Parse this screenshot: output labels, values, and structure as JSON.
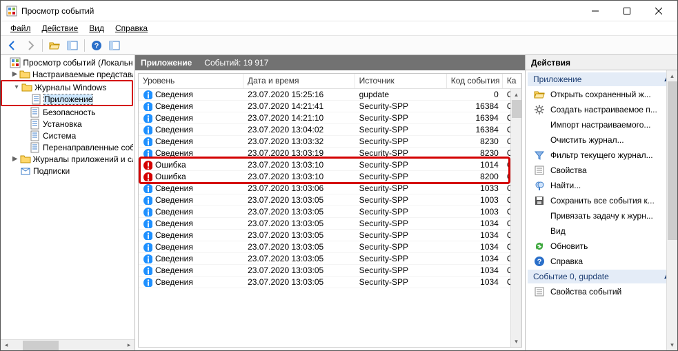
{
  "window": {
    "title": "Просмотр событий"
  },
  "menu": {
    "file": "Файл",
    "action": "Действие",
    "view": "Вид",
    "help": "Справка"
  },
  "tree": {
    "root": "Просмотр событий (Локальны",
    "custom": "Настраиваемые представле",
    "winlogs": "Журналы Windows",
    "application": "Приложение",
    "security": "Безопасность",
    "setup": "Установка",
    "system": "Система",
    "forwarded": "Перенаправленные соб",
    "appservlogs": "Журналы приложений и сл",
    "subscriptions": "Подписки"
  },
  "center": {
    "title": "Приложение",
    "count_label": "Событий: 19 917"
  },
  "columns": {
    "level": "Уровень",
    "datetime": "Дата и время",
    "source": "Источник",
    "code": "Код события",
    "category": "Ка"
  },
  "events": [
    {
      "level": "Сведения",
      "type": "info",
      "dt": "23.07.2020 15:25:16",
      "src": "gupdate",
      "code": "0",
      "cat": "О"
    },
    {
      "level": "Сведения",
      "type": "info",
      "dt": "23.07.2020 14:21:41",
      "src": "Security-SPP",
      "code": "16384",
      "cat": "О"
    },
    {
      "level": "Сведения",
      "type": "info",
      "dt": "23.07.2020 14:21:10",
      "src": "Security-SPP",
      "code": "16394",
      "cat": "О"
    },
    {
      "level": "Сведения",
      "type": "info",
      "dt": "23.07.2020 13:04:02",
      "src": "Security-SPP",
      "code": "16384",
      "cat": "О"
    },
    {
      "level": "Сведения",
      "type": "info",
      "dt": "23.07.2020 13:03:32",
      "src": "Security-SPP",
      "code": "8230",
      "cat": "О"
    },
    {
      "level": "Сведения",
      "type": "info",
      "dt": "23.07.2020 13:03:19",
      "src": "Security-SPP",
      "code": "8230",
      "cat": "О"
    },
    {
      "level": "Ошибка",
      "type": "error",
      "dt": "23.07.2020 13:03:10",
      "src": "Security-SPP",
      "code": "1014",
      "cat": "О"
    },
    {
      "level": "Ошибка",
      "type": "error",
      "dt": "23.07.2020 13:03:10",
      "src": "Security-SPP",
      "code": "8200",
      "cat": "О"
    },
    {
      "level": "Сведения",
      "type": "info",
      "dt": "23.07.2020 13:03:06",
      "src": "Security-SPP",
      "code": "1033",
      "cat": "О"
    },
    {
      "level": "Сведения",
      "type": "info",
      "dt": "23.07.2020 13:03:05",
      "src": "Security-SPP",
      "code": "1003",
      "cat": "О"
    },
    {
      "level": "Сведения",
      "type": "info",
      "dt": "23.07.2020 13:03:05",
      "src": "Security-SPP",
      "code": "1003",
      "cat": "О"
    },
    {
      "level": "Сведения",
      "type": "info",
      "dt": "23.07.2020 13:03:05",
      "src": "Security-SPP",
      "code": "1034",
      "cat": "О"
    },
    {
      "level": "Сведения",
      "type": "info",
      "dt": "23.07.2020 13:03:05",
      "src": "Security-SPP",
      "code": "1034",
      "cat": "О"
    },
    {
      "level": "Сведения",
      "type": "info",
      "dt": "23.07.2020 13:03:05",
      "src": "Security-SPP",
      "code": "1034",
      "cat": "О"
    },
    {
      "level": "Сведения",
      "type": "info",
      "dt": "23.07.2020 13:03:05",
      "src": "Security-SPP",
      "code": "1034",
      "cat": "О"
    },
    {
      "level": "Сведения",
      "type": "info",
      "dt": "23.07.2020 13:03:05",
      "src": "Security-SPP",
      "code": "1034",
      "cat": "О"
    },
    {
      "level": "Сведения",
      "type": "info",
      "dt": "23.07.2020 13:03:05",
      "src": "Security-SPP",
      "code": "1034",
      "cat": "О"
    }
  ],
  "actions": {
    "header": "Действия",
    "section1": "Приложение",
    "open_saved": "Открыть сохраненный ж...",
    "create_view": "Создать настраиваемое п...",
    "import_view": "Импорт настраиваемого...",
    "clear_log": "Очистить журнал...",
    "filter_log": "Фильтр текущего журнал...",
    "properties": "Свойства",
    "find": "Найти...",
    "save_all": "Сохранить все события к...",
    "attach_task": "Привязать задачу к журн...",
    "view": "Вид",
    "refresh": "Обновить",
    "help": "Справка",
    "section2": "Событие 0, gupdate",
    "event_props": "Свойства событий"
  },
  "icons": {
    "info_color": "#1e90ff",
    "error_color": "#d40000"
  }
}
